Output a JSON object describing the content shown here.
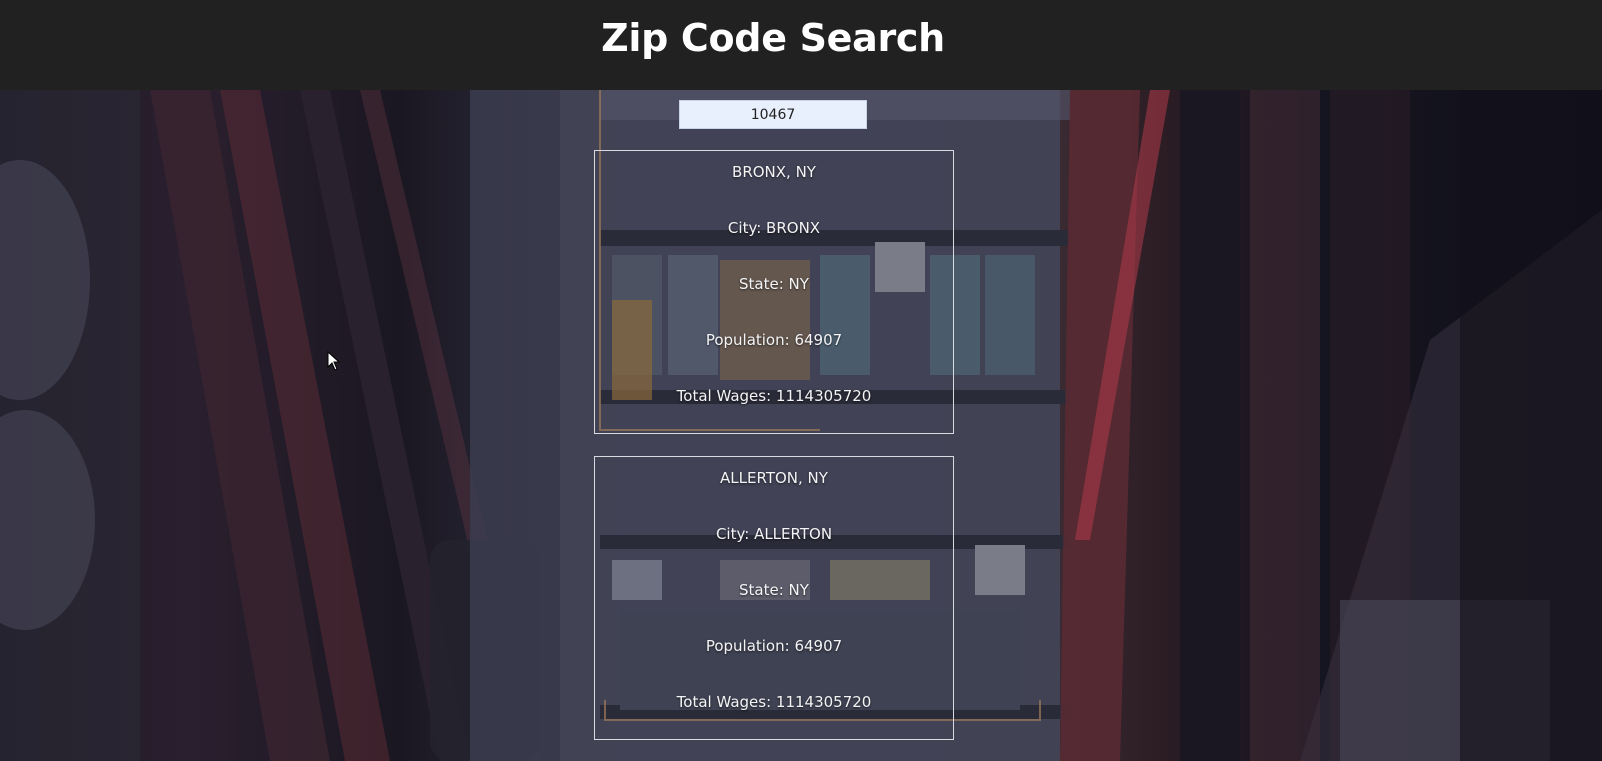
{
  "header": {
    "title": "Zip Code Search"
  },
  "search": {
    "value": "10467"
  },
  "results": [
    {
      "heading": "BRONX, NY",
      "city": "City: BRONX",
      "state": "State: NY",
      "population": "Population: 64907",
      "total_wages": "Total Wages: 1114305720"
    },
    {
      "heading": "ALLERTON, NY",
      "city": "City: ALLERTON",
      "state": "State: NY",
      "population": "Population: 64907",
      "total_wages": "Total Wages: 1114305720"
    }
  ],
  "colors": {
    "header_bg": "#212121",
    "input_bg": "#e8f0fe",
    "card_border": "#d9d9e0",
    "text": "#f4f4f6"
  }
}
